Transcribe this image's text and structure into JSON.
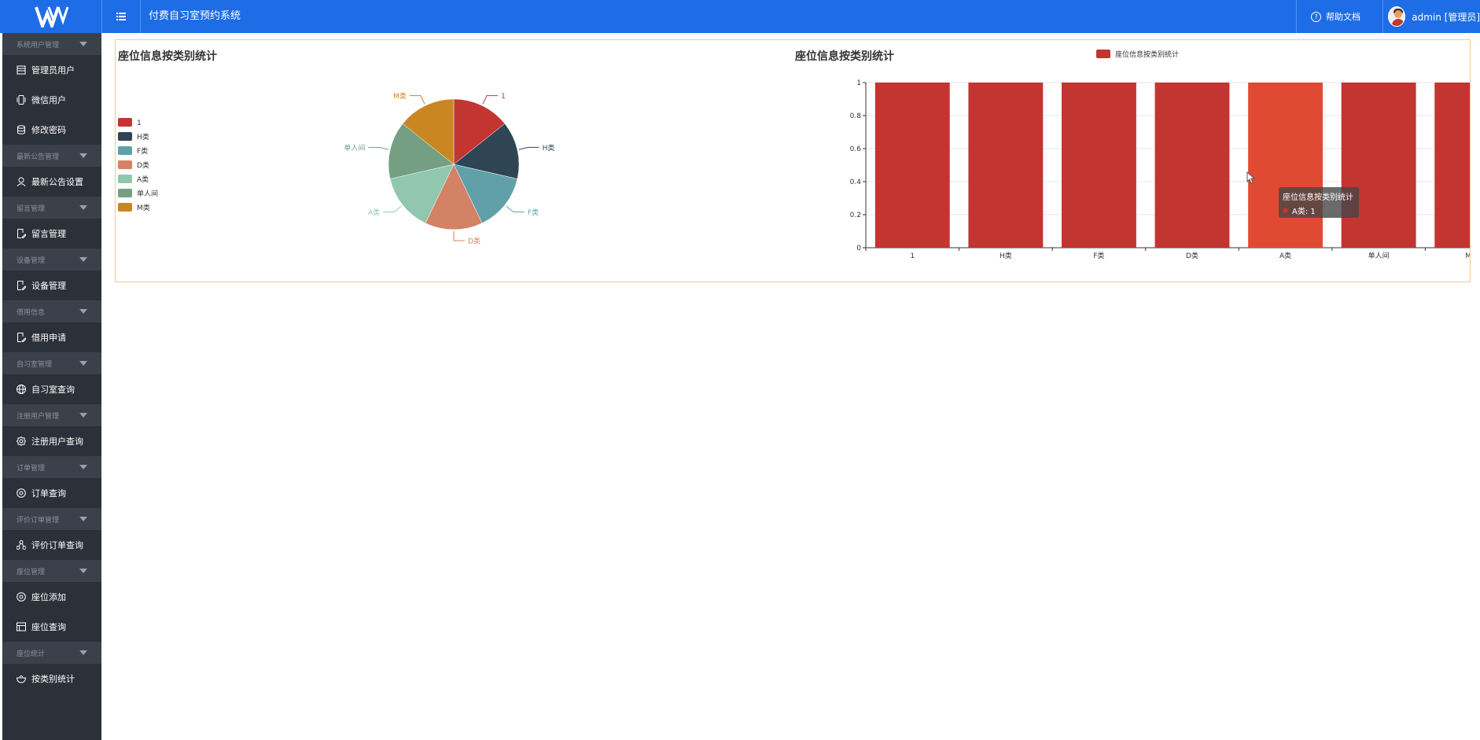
{
  "header": {
    "app_title": "付费自习室预约系统",
    "help_label": "帮助文档",
    "user_label": "admin [管理员]"
  },
  "sidebar": {
    "groups": [
      {
        "label": "系统用户管理",
        "items": [
          {
            "label": "管理员用户",
            "icon": "table-icon"
          },
          {
            "label": "微信用户",
            "icon": "phone-icon"
          },
          {
            "label": "修改密码",
            "icon": "database-icon"
          }
        ]
      },
      {
        "label": "最新公告管理",
        "items": [
          {
            "label": "最新公告设置",
            "icon": "user-icon"
          }
        ]
      },
      {
        "label": "留言管理",
        "items": [
          {
            "label": "留言管理",
            "icon": "doc-edit-icon"
          }
        ]
      },
      {
        "label": "设备管理",
        "items": [
          {
            "label": "设备管理",
            "icon": "doc-edit-icon"
          }
        ]
      },
      {
        "label": "借用信息",
        "items": [
          {
            "label": "借用申请",
            "icon": "doc-edit-icon"
          }
        ]
      },
      {
        "label": "自习室管理",
        "items": [
          {
            "label": "自习室查询",
            "icon": "globe-icon"
          }
        ]
      },
      {
        "label": "注册用户管理",
        "items": [
          {
            "label": "注册用户查询",
            "icon": "gear-icon"
          }
        ]
      },
      {
        "label": "订单管理",
        "items": [
          {
            "label": "订单查询",
            "icon": "circle-icon"
          }
        ]
      },
      {
        "label": "评价订单管理",
        "items": [
          {
            "label": "评价订单查询",
            "icon": "share-icon"
          }
        ]
      },
      {
        "label": "座位管理",
        "items": [
          {
            "label": "座位添加",
            "icon": "circle-icon"
          },
          {
            "label": "座位查询",
            "icon": "list-icon"
          }
        ]
      },
      {
        "label": "座位统计",
        "items": [
          {
            "label": "按类别统计",
            "icon": "bowl-icon"
          }
        ]
      }
    ]
  },
  "chart_data": [
    {
      "type": "pie",
      "title": "座位信息按类别统计",
      "categories": [
        "1",
        "H类",
        "F类",
        "D类",
        "A类",
        "单人间",
        "M类"
      ],
      "values": [
        1,
        1,
        1,
        1,
        1,
        1,
        1
      ],
      "colors": [
        "#c23531",
        "#2f4554",
        "#61a0a8",
        "#d48265",
        "#91c7ae",
        "#749f83",
        "#ca8622"
      ],
      "legend_position": "left"
    },
    {
      "type": "bar",
      "title": "座位信息按类别统计",
      "series": [
        {
          "name": "座位信息按类别统计",
          "values": [
            1,
            1,
            1,
            1,
            1,
            1,
            1
          ]
        }
      ],
      "categories": [
        "1",
        "H类",
        "F类",
        "D类",
        "A类",
        "单人间",
        "M类"
      ],
      "ylim": [
        0,
        1
      ],
      "yticks": [
        "0",
        "0.2",
        "0.4",
        "0.6",
        "0.8",
        "1"
      ],
      "bar_color": "#c23531",
      "highlight_color": "#e04a33",
      "legend_position": "top",
      "tooltip": {
        "title": "座位信息按类别统计",
        "line": "A类: 1"
      }
    }
  ]
}
